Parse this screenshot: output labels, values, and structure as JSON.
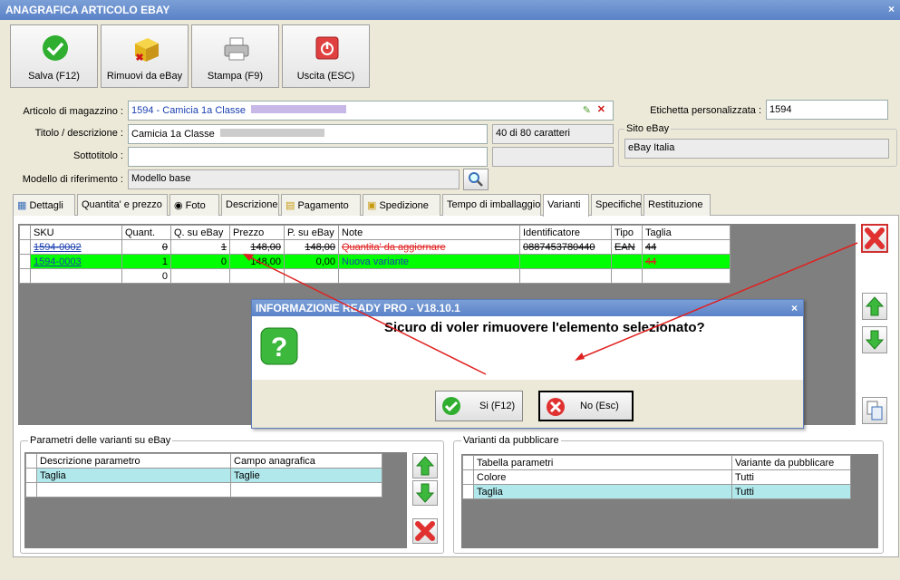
{
  "window": {
    "title": "ANAGRAFICA ARTICOLO EBAY",
    "close": "×"
  },
  "toolbar": {
    "save": "Salva (F12)",
    "remove": "Rimuovi da eBay",
    "print": "Stampa (F9)",
    "exit": "Uscita (ESC)"
  },
  "form": {
    "articolo_label": "Articolo di magazzino :",
    "articolo_value": "1594 - Camicia 1a Classe",
    "titolo_label": "Titolo / descrizione :",
    "titolo_value": "Camicia 1a Classe",
    "titolo_counter": "40 di 80 caratteri",
    "sottotitolo_label": "Sottotitolo :",
    "sottotitolo_value": "",
    "modello_label": "Modello di riferimento :",
    "modello_value": "Modello base",
    "etichetta_label": "Etichetta personalizzata :",
    "etichetta_value": "1594",
    "sito_label": "Sito eBay",
    "sito_value": "eBay Italia"
  },
  "tabs": [
    "Dettagli",
    "Quantita' e prezzo",
    "Foto",
    "Descrizione",
    "Pagamento",
    "Spedizione",
    "Tempo di imballaggio",
    "Varianti",
    "Specifiche",
    "Restituzione"
  ],
  "variants_table": {
    "headers": [
      "SKU",
      "Quant.",
      "Q. su eBay",
      "Prezzo",
      "P. su eBay",
      "Note",
      "Identificatore",
      "Tipo",
      "Taglia"
    ],
    "rows": [
      [
        "1594-0002",
        "0",
        "1",
        "148,00",
        "148,00",
        "Quantita' da aggiornare",
        "0887453780440",
        "EAN",
        "44"
      ],
      [
        "1594-0003",
        "1",
        "0",
        "148,00",
        "0,00",
        "Nuova variante",
        "",
        "",
        "44"
      ],
      [
        "",
        "0",
        "",
        "",
        "",
        "",
        "",
        "",
        ""
      ]
    ]
  },
  "dialog": {
    "title": "INFORMAZIONE READY PRO - V18.10.1",
    "message": "Sicuro di voler rimuovere l'elemento selezionato?",
    "yes": "Si (F12)",
    "no": "No (Esc)",
    "close": "×"
  },
  "params_group": {
    "title": "Parametri delle varianti su eBay",
    "headers": [
      "Descrizione parametro",
      "Campo anagrafica"
    ],
    "rows": [
      [
        "Taglia",
        "Taglie"
      ],
      [
        "",
        ""
      ]
    ]
  },
  "publish_group": {
    "title": "Varianti da pubblicare",
    "headers": [
      "Tabella parametri",
      "Variante da pubblicare"
    ],
    "rows": [
      [
        "Colore",
        "Tutti"
      ],
      [
        "Taglia",
        "Tutti"
      ]
    ]
  },
  "colors": {
    "green_row": "#00ff00",
    "selected_row": "#b0e8ec",
    "red_text": "#e02020",
    "blue_text": "#1a3fb0"
  }
}
